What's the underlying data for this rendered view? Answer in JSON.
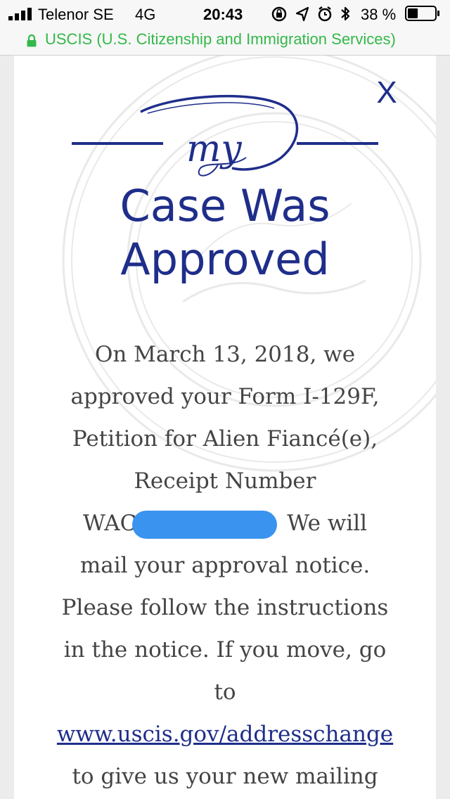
{
  "status_bar": {
    "carrier": "Telenor SE",
    "network": "4G",
    "time": "20:43",
    "battery_percent": "38 %",
    "battery_level": 0.38
  },
  "url_bar": {
    "site": "USCIS (U.S. Citizenship and Immigration Services)",
    "secure_color": "#34b84a"
  },
  "modal": {
    "close_label": "X",
    "logo_text": "my",
    "title_line1": "Case Was",
    "title_line2": "Approved",
    "body": {
      "line1": "On March 13, 2018, we",
      "line2": "approved your Form I-129F,",
      "line3": "Petition for Alien Fiancé(e),",
      "line4": "Receipt Number",
      "receipt_prefix": "WAC",
      "line5_suffix": " We will",
      "line6": "mail your approval notice.",
      "line7": "Please follow the instructions",
      "line8": "in the notice. If you move, go",
      "line9": "to",
      "link": "www.uscis.gov/addresschange",
      "line10": "to give us your new mailing"
    },
    "accent_color": "#1f2e8a",
    "redaction_color": "#3a93ee"
  }
}
